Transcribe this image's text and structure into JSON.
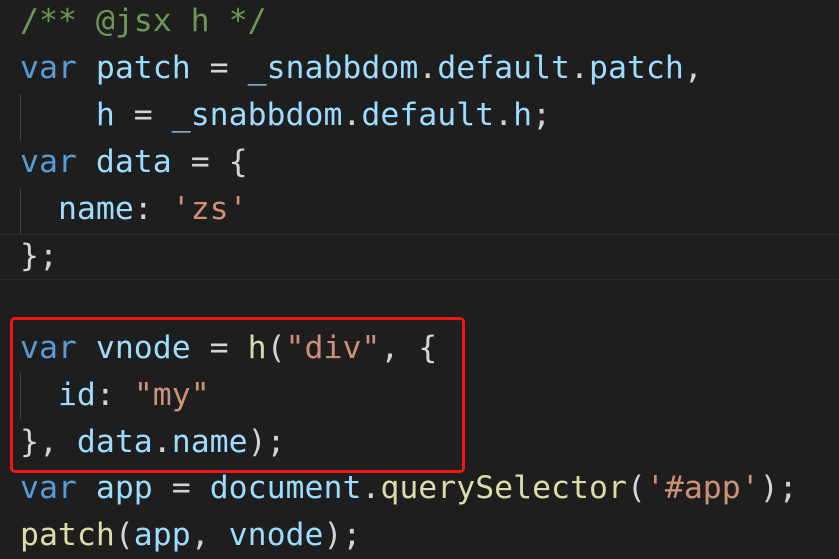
{
  "editor": {
    "lines": [
      [
        {
          "t": "/** @jsx h */",
          "c": "comment"
        }
      ],
      [
        {
          "t": "var",
          "c": "kw"
        },
        {
          "t": " ",
          "c": "txt"
        },
        {
          "t": "patch",
          "c": "var"
        },
        {
          "t": " = ",
          "c": "txt"
        },
        {
          "t": "_snabbdom",
          "c": "var"
        },
        {
          "t": ".",
          "c": "txt"
        },
        {
          "t": "default",
          "c": "var"
        },
        {
          "t": ".",
          "c": "txt"
        },
        {
          "t": "patch",
          "c": "var"
        },
        {
          "t": ",",
          "c": "txt"
        }
      ],
      [
        {
          "t": "    ",
          "c": "txt"
        },
        {
          "t": "h",
          "c": "var"
        },
        {
          "t": " = ",
          "c": "txt"
        },
        {
          "t": "_snabbdom",
          "c": "var"
        },
        {
          "t": ".",
          "c": "txt"
        },
        {
          "t": "default",
          "c": "var"
        },
        {
          "t": ".",
          "c": "txt"
        },
        {
          "t": "h",
          "c": "var"
        },
        {
          "t": ";",
          "c": "txt"
        }
      ],
      [
        {
          "t": "var",
          "c": "kw"
        },
        {
          "t": " ",
          "c": "txt"
        },
        {
          "t": "data",
          "c": "var"
        },
        {
          "t": " = {",
          "c": "txt"
        }
      ],
      [
        {
          "t": "  ",
          "c": "txt"
        },
        {
          "t": "name",
          "c": "var"
        },
        {
          "t": ": ",
          "c": "txt"
        },
        {
          "t": "'zs'",
          "c": "str"
        }
      ],
      [
        {
          "t": "};",
          "c": "txt"
        }
      ],
      [],
      [
        {
          "t": "var",
          "c": "kw"
        },
        {
          "t": " ",
          "c": "txt"
        },
        {
          "t": "vnode",
          "c": "var"
        },
        {
          "t": " = ",
          "c": "txt"
        },
        {
          "t": "h",
          "c": "fn"
        },
        {
          "t": "(",
          "c": "txt"
        },
        {
          "t": "\"div\"",
          "c": "str"
        },
        {
          "t": ", {",
          "c": "txt"
        }
      ],
      [
        {
          "t": "  ",
          "c": "txt"
        },
        {
          "t": "id",
          "c": "var"
        },
        {
          "t": ": ",
          "c": "txt"
        },
        {
          "t": "\"my\"",
          "c": "str"
        }
      ],
      [
        {
          "t": "}, ",
          "c": "txt"
        },
        {
          "t": "data",
          "c": "var"
        },
        {
          "t": ".",
          "c": "txt"
        },
        {
          "t": "name",
          "c": "var"
        },
        {
          "t": ");",
          "c": "txt"
        }
      ],
      [
        {
          "t": "var",
          "c": "kw"
        },
        {
          "t": " ",
          "c": "txt"
        },
        {
          "t": "app",
          "c": "var"
        },
        {
          "t": " = ",
          "c": "txt"
        },
        {
          "t": "document",
          "c": "var"
        },
        {
          "t": ".",
          "c": "txt"
        },
        {
          "t": "querySelector",
          "c": "fn"
        },
        {
          "t": "(",
          "c": "txt"
        },
        {
          "t": "'#app'",
          "c": "str"
        },
        {
          "t": ");",
          "c": "txt"
        }
      ],
      [
        {
          "t": "patch",
          "c": "fn"
        },
        {
          "t": "(",
          "c": "txt"
        },
        {
          "t": "app",
          "c": "var"
        },
        {
          "t": ", ",
          "c": "txt"
        },
        {
          "t": "vnode",
          "c": "var"
        },
        {
          "t": ");",
          "c": "txt"
        }
      ]
    ]
  },
  "colors": {
    "background": "#1e1e1e",
    "comment": "#6a9955",
    "keyword": "#569cd6",
    "variable": "#9cdcfe",
    "function": "#dcdcaa",
    "string": "#ce9178",
    "text": "#d4d4d4",
    "annotation_box": "#f31414"
  }
}
